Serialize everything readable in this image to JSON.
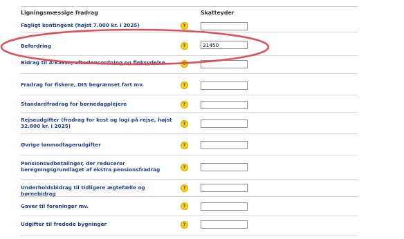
{
  "table": {
    "header_label": "Ligningsmæssige fradrag",
    "header_column": "Skatteyder",
    "help_glyph": "?",
    "rows": [
      {
        "label": "Fagligt kontingent (højst 7.000 kr. i 2025)",
        "value": ""
      },
      {
        "label": "Befordring",
        "value": "21450"
      },
      {
        "label": "Bidrag til A-kasse, efterlønsordning og fleksydelse",
        "value": ""
      },
      {
        "label": "Fradrag for fiskere, DIS begrænset fart mv.",
        "value": ""
      },
      {
        "label": "Standardfradrag for børnedagplejere",
        "value": ""
      },
      {
        "label": "Rejseudgifter (fradrag for kost og logi på rejse, højst 32.800 kr. i 2025)",
        "value": ""
      },
      {
        "label": "Øvrige lønmodtagerudgifter",
        "value": ""
      },
      {
        "label": "Pensionsudbetalinger, der reducerer beregningsgrundlaget af ekstra pensionsfradrag",
        "value": ""
      },
      {
        "label": "Underholdsbidrag til tidligere ægtefælle og børnebidrag",
        "value": ""
      },
      {
        "label": "Gaver til foreninger mv.",
        "value": ""
      },
      {
        "label": "Udgifter til fredede bygninger",
        "value": ""
      }
    ]
  },
  "annotation_color": "#e0505a"
}
